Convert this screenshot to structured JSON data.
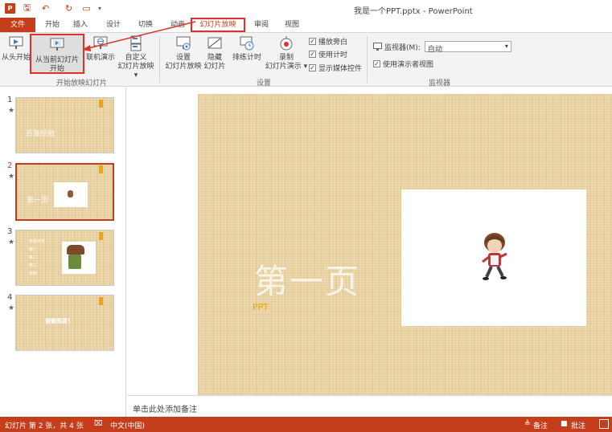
{
  "window": {
    "title": "我是一个PPT.pptx - PowerPoint"
  },
  "quick_access": {
    "items": [
      {
        "icon": "powerpoint-logo-icon",
        "glyph": "P"
      },
      {
        "icon": "save-icon",
        "glyph": "🖫"
      },
      {
        "icon": "undo-icon",
        "glyph": "↶"
      },
      {
        "icon": "redo-icon",
        "glyph": "↻"
      },
      {
        "icon": "start-from-beginning-icon",
        "glyph": "▭"
      },
      {
        "icon": "customize-arrow-icon",
        "glyph": "▾"
      }
    ]
  },
  "tabs": [
    {
      "label": "文件"
    },
    {
      "label": "开始"
    },
    {
      "label": "插入"
    },
    {
      "label": "设计"
    },
    {
      "label": "切换"
    },
    {
      "label": "动画"
    },
    {
      "label": "幻灯片放映"
    },
    {
      "label": "审阅"
    },
    {
      "label": "视图"
    }
  ],
  "ribbon": {
    "group1": {
      "label": "开始放映幻灯片",
      "from_beginning": "从头开始",
      "from_current_line1": "从当前幻灯片",
      "from_current_line2": "开始",
      "online_present": "联机演示",
      "custom_line1": "自定义",
      "custom_line2": "幻灯片放映"
    },
    "group2": {
      "label": "设置",
      "setup_line1": "设置",
      "setup_line2": "幻灯片放映",
      "hide_line1": "隐藏",
      "hide_line2": "幻灯片",
      "rehearse": "排练计时",
      "record_line1": "录制",
      "record_line2": "幻灯片演示",
      "play_narrations": "播放旁白",
      "use_timings": "使用计时",
      "show_media_controls": "显示媒体控件"
    },
    "group3": {
      "label": "监视器",
      "monitor_label": "监视器(M):",
      "monitor_value": "自动",
      "presenter_view": "使用演示者视图"
    }
  },
  "thumbnails": [
    {
      "num": "1",
      "star": "★",
      "text": "百度经验"
    },
    {
      "num": "2",
      "star": "★",
      "text": "第一页"
    },
    {
      "num": "3",
      "star": "★",
      "text_lines": [
        "音效大全",
        "第一",
        "第二",
        "第三",
        "第四"
      ]
    },
    {
      "num": "4",
      "star": "★",
      "text": "谢谢观赏！"
    }
  ],
  "slide": {
    "title": "第一页",
    "subtitle": "PPT"
  },
  "notes": {
    "placeholder": "单击此处添加备注"
  },
  "status": {
    "slide_info": "幻灯片 第 2 张，共 4 张",
    "language": "中文(中国)",
    "notes": "备注",
    "comments": "批注"
  },
  "colors": {
    "accent": "#c43e1c",
    "highlight": "#e0302a",
    "orange": "#f0a30a"
  }
}
